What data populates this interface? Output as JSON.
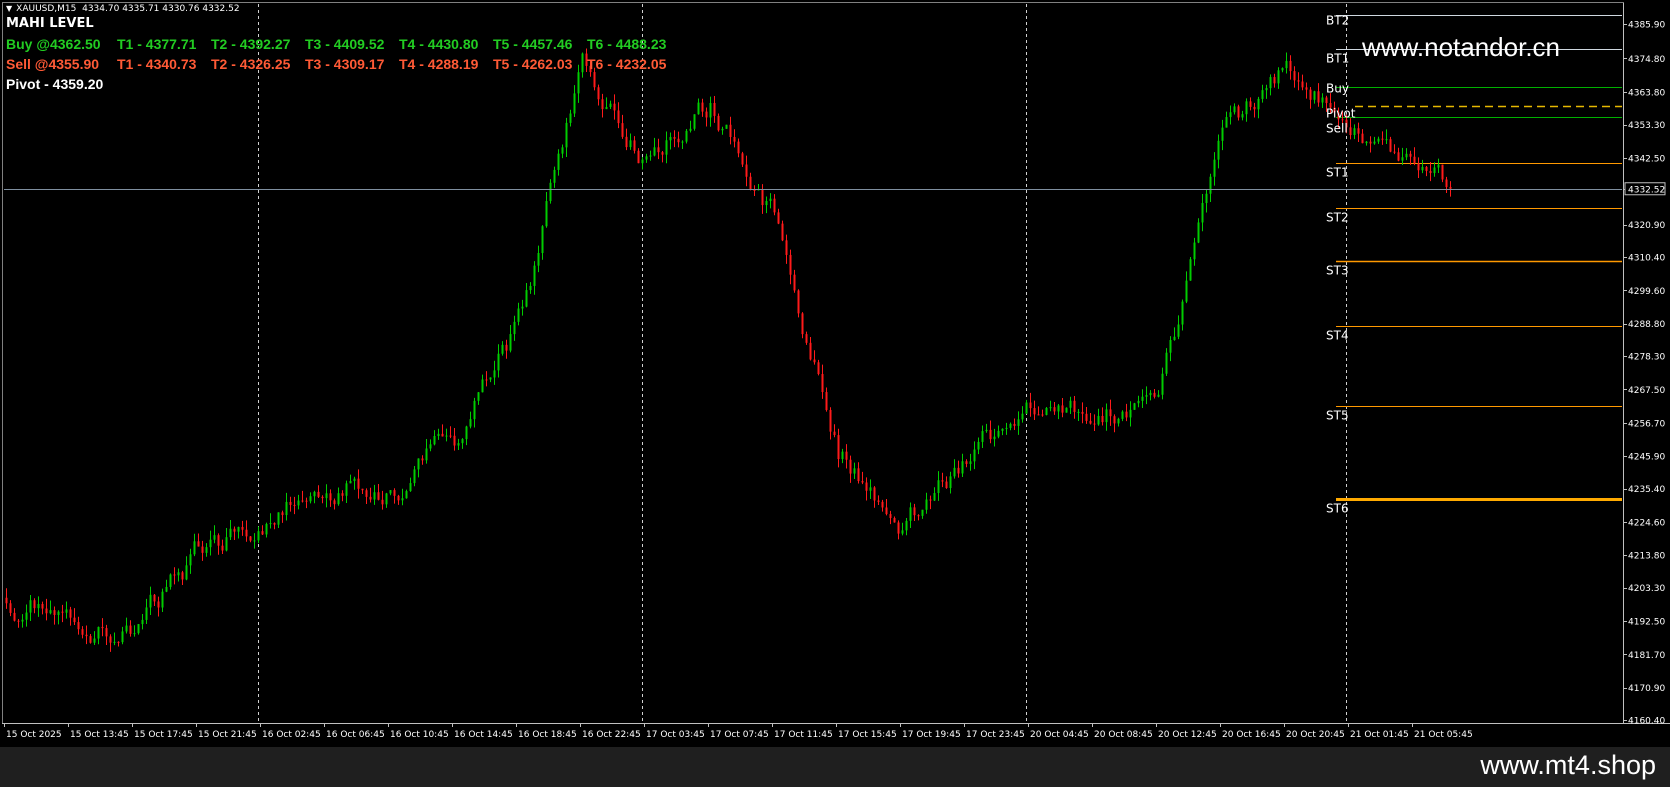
{
  "symbol_bar": {
    "symbol": "XAUUSD,M15",
    "ohlc": "4334.70 4335.71 4330.76 4332.52"
  },
  "indicator": {
    "title": "MAHI LEVEL",
    "buy_label": "Buy @4362.50",
    "buy_targets": [
      "T1 - 4377.71",
      "T2 - 4392.27",
      "T3 - 4409.52",
      "T4 - 4430.80",
      "T5 - 4457.46",
      "T6 - 4488.23"
    ],
    "sell_label": "Sell @4355.90",
    "sell_targets": [
      "T1 - 4340.73",
      "T2 - 4326.25",
      "T3 - 4309.17",
      "T4 - 4288.19",
      "T5 - 4262.03",
      "T6 - 4232.05"
    ],
    "pivot_label": "Pivot - 4359.20"
  },
  "watermarks": {
    "top": "www.notandor.cn",
    "bottom": "www.mt4.shop"
  },
  "colors": {
    "background": "#000000",
    "bull": "#00cc00",
    "bear": "#ff1a1a",
    "buy_text": "#22cc22",
    "sell_text": "#ff5a36",
    "level_orange": "#ff9900",
    "level_green": "#00b000",
    "pivot_dash": "#e6b800"
  },
  "chart_data": {
    "type": "candlestick",
    "title": "",
    "xlabel": "",
    "ylabel": "",
    "ylim": [
      4160.0,
      4392.0
    ],
    "price_ticks": [
      "4385.90",
      "4374.80",
      "4363.80",
      "4353.30",
      "4342.50",
      "4332.52",
      "4320.90",
      "4310.40",
      "4299.60",
      "4288.80",
      "4278.30",
      "4267.50",
      "4256.70",
      "4245.90",
      "4235.40",
      "4224.60",
      "4213.80",
      "4203.30",
      "4192.50",
      "4181.70",
      "4170.90",
      "4160.40"
    ],
    "time_labels": [
      "15 Oct 2025",
      "15 Oct 13:45",
      "15 Oct 17:45",
      "15 Oct 21:45",
      "16 Oct 02:45",
      "16 Oct 06:45",
      "16 Oct 10:45",
      "16 Oct 14:45",
      "16 Oct 18:45",
      "16 Oct 22:45",
      "17 Oct 03:45",
      "17 Oct 07:45",
      "17 Oct 11:45",
      "17 Oct 15:45",
      "17 Oct 19:45",
      "17 Oct 23:45",
      "20 Oct 04:45",
      "20 Oct 08:45",
      "20 Oct 12:45",
      "20 Oct 16:45",
      "20 Oct 20:45",
      "21 Oct 01:45",
      "21 Oct 05:45"
    ],
    "current_price": "4332.52",
    "day_separators_after_label": [
      "15 Oct 21:45",
      "16 Oct 22:45",
      "17 Oct 23:45",
      "20 Oct 20:45"
    ],
    "price_path": [
      {
        "t": "15 Oct 2025",
        "p": 4200
      },
      {
        "t": "15 Oct 13:45",
        "p": 4197
      },
      {
        "t": "15 Oct 17:45",
        "p": 4188
      },
      {
        "t": "15 Oct 21:45",
        "p": 4213
      },
      {
        "t": "16 Oct 02:45",
        "p": 4226
      },
      {
        "t": "16 Oct 06:45",
        "p": 4238
      },
      {
        "t": "16 Oct 10:45",
        "p": 4237
      },
      {
        "t": "16 Oct 14:45",
        "p": 4250
      },
      {
        "t": "16 Oct 18:45",
        "p": 4287
      },
      {
        "t": "16 Oct 22:45",
        "p": 4370
      },
      {
        "t": "17 Oct 03:45",
        "p": 4345
      },
      {
        "t": "17 Oct 07:45",
        "p": 4360
      },
      {
        "t": "17 Oct 11:45",
        "p": 4325
      },
      {
        "t": "17 Oct 15:45",
        "p": 4250
      },
      {
        "t": "17 Oct 19:45",
        "p": 4222
      },
      {
        "t": "17 Oct 23:45",
        "p": 4246
      },
      {
        "t": "20 Oct 04:45",
        "p": 4262
      },
      {
        "t": "20 Oct 08:45",
        "p": 4258
      },
      {
        "t": "20 Oct 12:45",
        "p": 4268
      },
      {
        "t": "20 Oct 16:45",
        "p": 4343
      },
      {
        "t": "20 Oct 20:45",
        "p": 4370
      },
      {
        "t": "21 Oct 01:45",
        "p": 4355
      },
      {
        "t": "21 Oct 05:45",
        "p": 4332
      }
    ],
    "levels": [
      {
        "name": "BT2",
        "price": 4388.7,
        "color": "#cfd8e0",
        "width": 1,
        "dash": false
      },
      {
        "name": "BT1",
        "price": 4377.71,
        "color": "#cfd8e0",
        "width": 1,
        "dash": false
      },
      {
        "name": "Buy",
        "price": 4365.5,
        "color": "#00b000",
        "width": 1,
        "dash": false
      },
      {
        "name": "Pivot",
        "price": 4359.2,
        "color": "#e6b800",
        "width": 1.5,
        "dash": true
      },
      {
        "name": "Sell",
        "price": 4355.9,
        "color": "#00b000",
        "width": 1,
        "dash": false
      },
      {
        "name": "ST1",
        "price": 4340.73,
        "color": "#ff9900",
        "width": 1,
        "dash": false
      },
      {
        "name": "ST2",
        "price": 4326.25,
        "color": "#ff9900",
        "width": 1,
        "dash": false
      },
      {
        "name": "ST3",
        "price": 4309.17,
        "color": "#ff9900",
        "width": 1.5,
        "dash": false
      },
      {
        "name": "ST4",
        "price": 4288.19,
        "color": "#ff9900",
        "width": 1,
        "dash": false
      },
      {
        "name": "ST5",
        "price": 4262.03,
        "color": "#ff9900",
        "width": 1,
        "dash": false
      },
      {
        "name": "ST6",
        "price": 4232.05,
        "color": "#ffaa00",
        "width": 3,
        "dash": false
      }
    ],
    "grid": false
  }
}
